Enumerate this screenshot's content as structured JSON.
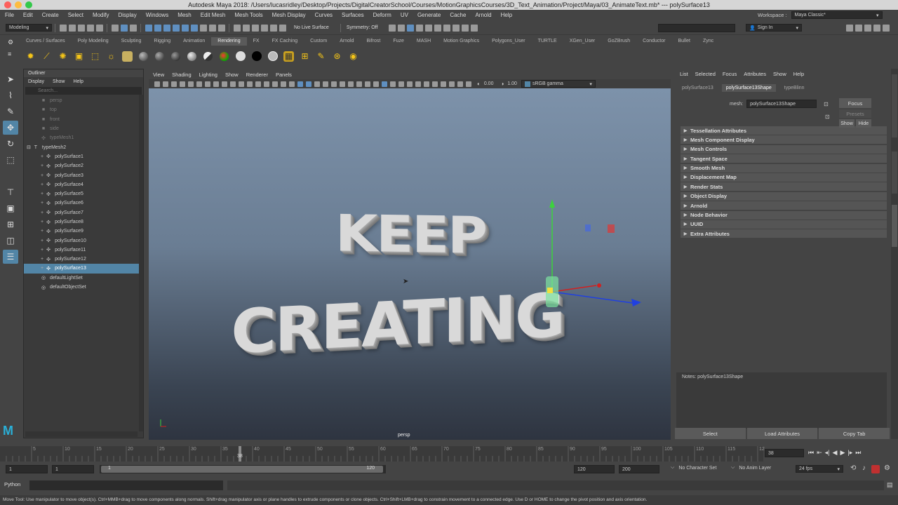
{
  "window": {
    "title": "Autodesk Maya 2018: /Users/lucasridley/Desktop/Projects/DigitalCreatorSchool/Courses/MotionGraphicsCourses/3D_Text_Animation/Project/Maya/03_AnimateText.mb*   ---   polySurface13"
  },
  "menubar": {
    "items": [
      "File",
      "Edit",
      "Create",
      "Select",
      "Modify",
      "Display",
      "Windows",
      "Mesh",
      "Edit Mesh",
      "Mesh Tools",
      "Mesh Display",
      "Curves",
      "Surfaces",
      "Deform",
      "UV",
      "Generate",
      "Cache",
      "Arnold",
      "Help"
    ],
    "workspace_label": "Workspace :",
    "workspace_value": "Maya Classic*"
  },
  "toolbar": {
    "mode": "Modeling",
    "live_surface": "No Live Surface",
    "symmetry": "Symmetry: Off",
    "sign_in": "Sign In"
  },
  "shelf": {
    "tabs": [
      "Curves / Surfaces",
      "Poly Modeling",
      "Sculpting",
      "Rigging",
      "Animation",
      "Rendering",
      "FX",
      "FX Caching",
      "Custom",
      "Arnold",
      "Bifrost",
      "Fuze",
      "MASH",
      "Motion Graphics",
      "Polygons_User",
      "TURTLE",
      "XGen_User",
      "GoZBrush",
      "Conductor",
      "Bullet",
      "Zync"
    ],
    "active_tab": "Rendering"
  },
  "outliner": {
    "title": "Outliner",
    "menu": [
      "Display",
      "Show",
      "Help"
    ],
    "search_placeholder": "Search...",
    "items": [
      {
        "label": "persp",
        "dim": true,
        "indent": 1,
        "icon": "camera-icon"
      },
      {
        "label": "top",
        "dim": true,
        "indent": 1,
        "icon": "camera-icon"
      },
      {
        "label": "front",
        "dim": true,
        "indent": 1,
        "icon": "camera-icon"
      },
      {
        "label": "side",
        "dim": true,
        "indent": 1,
        "icon": "camera-icon"
      },
      {
        "label": "typeMesh1",
        "dim": true,
        "indent": 1,
        "icon": "transform-icon"
      },
      {
        "label": "typeMesh2",
        "dim": false,
        "indent": 0,
        "icon": "type-icon",
        "expanded": true
      },
      {
        "label": "polySurface1",
        "dim": false,
        "indent": 2,
        "icon": "transform-icon"
      },
      {
        "label": "polySurface2",
        "dim": false,
        "indent": 2,
        "icon": "transform-icon"
      },
      {
        "label": "polySurface3",
        "dim": false,
        "indent": 2,
        "icon": "transform-icon"
      },
      {
        "label": "polySurface4",
        "dim": false,
        "indent": 2,
        "icon": "transform-icon"
      },
      {
        "label": "polySurface5",
        "dim": false,
        "indent": 2,
        "icon": "transform-icon"
      },
      {
        "label": "polySurface6",
        "dim": false,
        "indent": 2,
        "icon": "transform-icon"
      },
      {
        "label": "polySurface7",
        "dim": false,
        "indent": 2,
        "icon": "transform-icon"
      },
      {
        "label": "polySurface8",
        "dim": false,
        "indent": 2,
        "icon": "transform-icon"
      },
      {
        "label": "polySurface9",
        "dim": false,
        "indent": 2,
        "icon": "transform-icon"
      },
      {
        "label": "polySurface10",
        "dim": false,
        "indent": 2,
        "icon": "transform-icon"
      },
      {
        "label": "polySurface11",
        "dim": false,
        "indent": 2,
        "icon": "transform-icon"
      },
      {
        "label": "polySurface12",
        "dim": false,
        "indent": 2,
        "icon": "transform-icon"
      },
      {
        "label": "polySurface13",
        "dim": false,
        "indent": 2,
        "icon": "transform-icon",
        "selected": true
      },
      {
        "label": "defaultLightSet",
        "dim": false,
        "indent": 1,
        "icon": "set-icon"
      },
      {
        "label": "defaultObjectSet",
        "dim": false,
        "indent": 1,
        "icon": "set-icon"
      }
    ]
  },
  "viewport": {
    "menu": [
      "View",
      "Shading",
      "Lighting",
      "Show",
      "Renderer",
      "Panels"
    ],
    "field1": "0.00",
    "field2": "1.00",
    "color_space": "sRGB gamma",
    "camera_label": "persp",
    "text_line1": "KEEP",
    "text_line2": "CREATING"
  },
  "attribute_editor": {
    "menu": [
      "List",
      "Selected",
      "Focus",
      "Attributes",
      "Show",
      "Help"
    ],
    "tabs": [
      "polySurface13",
      "polySurface13Shape",
      "typeBlinn"
    ],
    "active_tab": "polySurface13Shape",
    "focus_label": "Focus",
    "presets_label": "Presets",
    "show_label": "Show",
    "hide_label": "Hide",
    "mesh_label": "mesh:",
    "mesh_value": "polySurface13Shape",
    "sections": [
      "Tessellation Attributes",
      "Mesh Component Display",
      "Mesh Controls",
      "Tangent Space",
      "Smooth Mesh",
      "Displacement Map",
      "Render Stats",
      "Object Display",
      "Arnold",
      "Node Behavior",
      "UUID",
      "Extra Attributes"
    ],
    "notes_label": "Notes:  polySurface13Shape",
    "buttons": [
      "Select",
      "Load Attributes",
      "Copy Tab"
    ],
    "side_tabs": [
      "Channel Box / Layer Editor",
      "Modeling Toolkit",
      "Attribute Editor"
    ]
  },
  "timeline": {
    "ticks": [
      "5",
      "10",
      "15",
      "20",
      "25",
      "30",
      "35",
      "40",
      "45",
      "50",
      "55",
      "60",
      "65",
      "70",
      "75",
      "80",
      "85",
      "90",
      "95",
      "100",
      "105",
      "110",
      "115",
      "120"
    ],
    "playhead_frame": 38,
    "range_start": 1,
    "range_end": 120,
    "current_frame": "38"
  },
  "range": {
    "start": "1",
    "start2": "1",
    "inner_start": "1",
    "inner_end": "120",
    "end": "120",
    "end2": "200",
    "character_set": "No Character Set",
    "anim_layer": "No Anim Layer",
    "fps": "24 fps"
  },
  "command_line": {
    "language": "Python"
  },
  "help_line": {
    "text": "Move Tool: Use manipulator to move object(s). Ctrl+MMB+drag to move components along normals. Shift+drag manipulator axis or plane handles to extrude components or clone objects. Ctrl+Shift+LMB+drag to constrain movement to a connected edge. Use D or HOME to change the pivot position and axis orientation."
  },
  "colors": {
    "selection": "#5285a6",
    "panel_bg": "#444444",
    "viewport_top": "#7d92aa",
    "viewport_bottom": "#2e3440",
    "axis_y": "#3dd23d",
    "axis_x": "#d22020",
    "axis_z": "#2040e0"
  }
}
